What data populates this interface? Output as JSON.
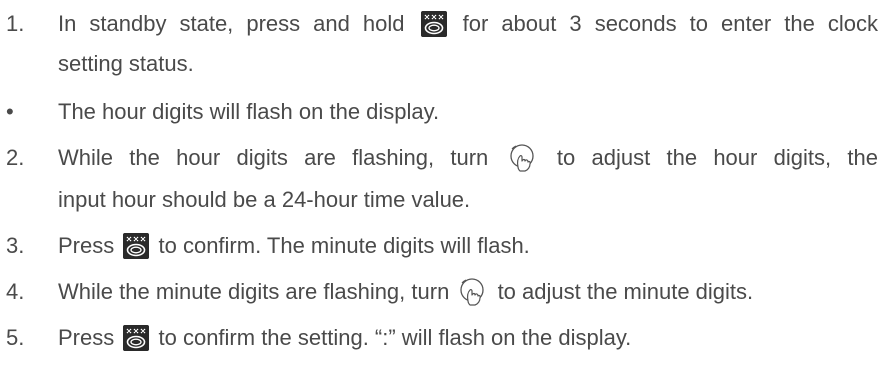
{
  "steps": [
    {
      "marker": "1.",
      "before": "In standby state, press and hold",
      "icon": "clock-button-icon",
      "after": "for about 3 seconds to enter the clock",
      "continuation": "setting status."
    },
    {
      "marker": "•",
      "text": "The hour digits will flash on the display."
    },
    {
      "marker": "2.",
      "before": "While the hour digits are flashing, turn",
      "icon": "rotary-knob-icon",
      "after": "to adjust the hour digits, the",
      "continuation": "input hour should be a 24-hour time value."
    },
    {
      "marker": "3.",
      "before": "Press",
      "icon": "clock-button-icon",
      "after": "to confirm. The minute digits will flash."
    },
    {
      "marker": "4.",
      "before": "While the minute digits are flashing, turn",
      "icon": "rotary-knob-icon",
      "after": "to adjust the minute digits."
    },
    {
      "marker": "5.",
      "before": "Press",
      "icon": "clock-button-icon",
      "after": "to confirm the setting. “:” will flash on the display."
    }
  ]
}
